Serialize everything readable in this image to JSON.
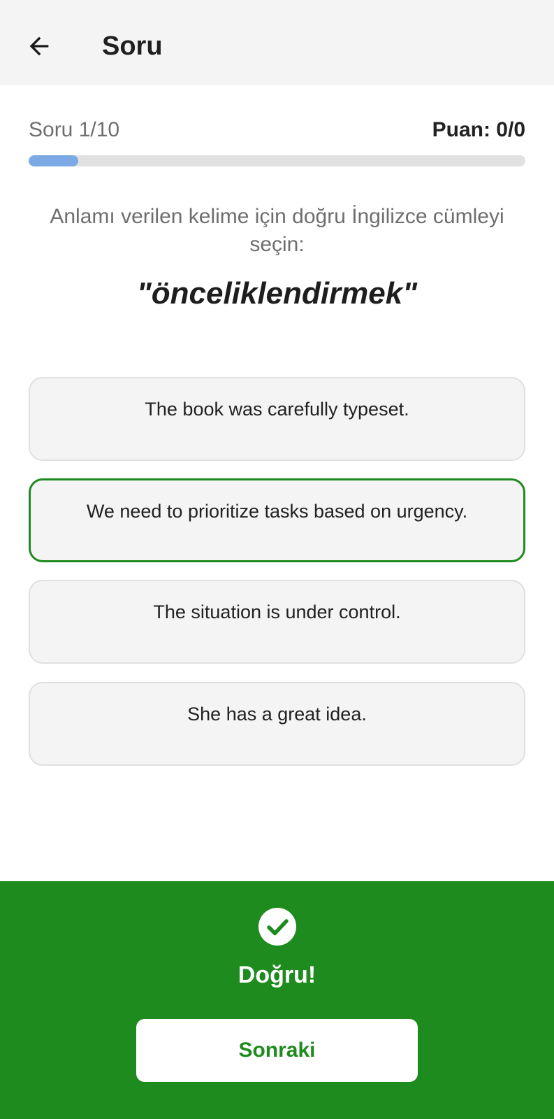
{
  "app_bar": {
    "title": "Soru",
    "back_icon": "arrow-left-icon"
  },
  "progress": {
    "label": "Soru 1/10",
    "score": "Puan: 0/0",
    "fraction": 0.1,
    "fill_color": "#7aa9e3"
  },
  "question": {
    "prompt": "Anlamı verilen kelime için doğru İngilizce cümleyi seçin:",
    "word": "\"önceliklendirmek\""
  },
  "options": [
    {
      "text": "The book was carefully typeset.",
      "selected": false
    },
    {
      "text": "We need to prioritize tasks based on urgency.",
      "selected": true
    },
    {
      "text": "The situation is under control.",
      "selected": false
    },
    {
      "text": "She has a great idea.",
      "selected": false
    }
  ],
  "result": {
    "icon": "check-circle-icon",
    "text": "Doğru!",
    "next_label": "Sonraki",
    "color": "#1e8b1e"
  }
}
